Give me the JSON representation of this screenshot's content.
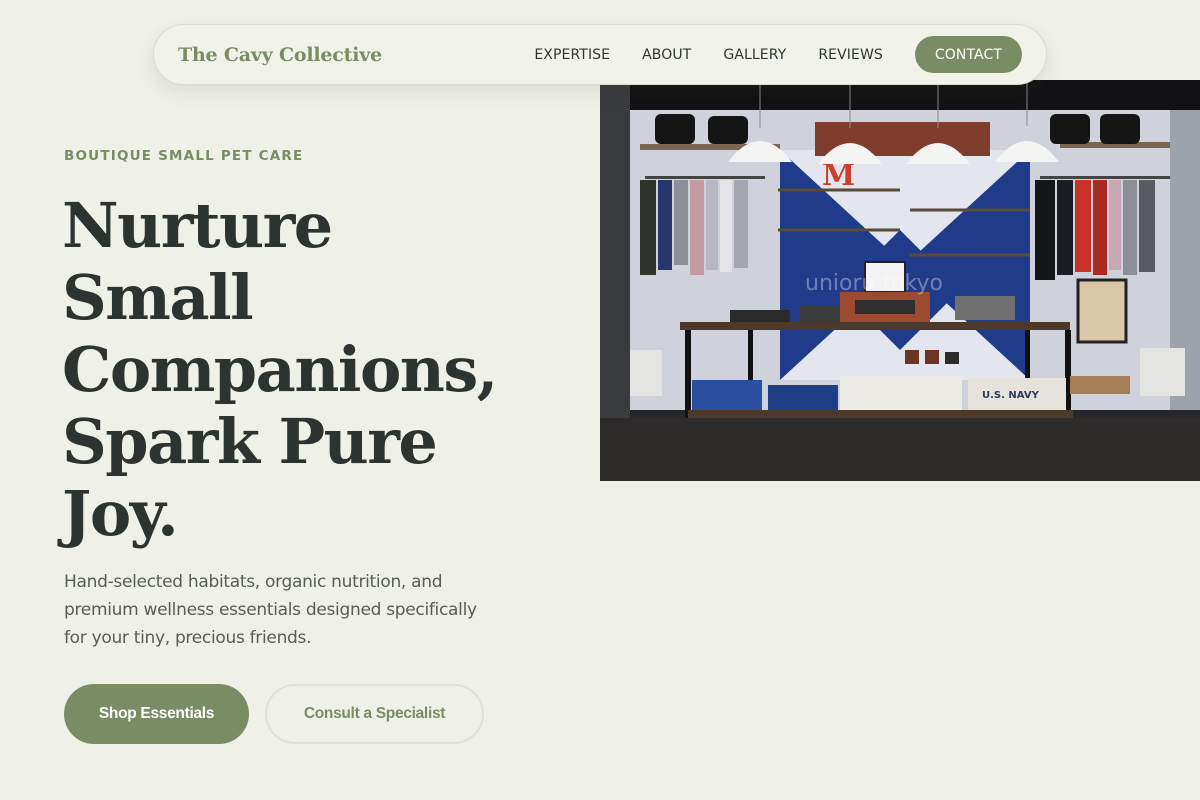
{
  "nav": {
    "brand": "The Cavy Collective",
    "links": [
      "EXPERTISE",
      "ABOUT",
      "GALLERY",
      "REVIEWS"
    ],
    "cta": "CONTACT"
  },
  "hero": {
    "eyebrow": "BOUTIQUE SMALL PET CARE",
    "headline_lines": [
      "Nurture",
      "Small",
      "Companions,",
      "Spark Pure",
      "Joy."
    ],
    "subhead": "Hand-selected habitats, organic nutrition, and premium wellness essentials designed specifically for your tiny, precious friends.",
    "primary_button": "Shop Essentials",
    "secondary_button": "Consult a Specialist"
  },
  "image": {
    "watermark_text": "unioru tokyo",
    "sign_letter": "M",
    "crate_text": "U.S. NAVY"
  },
  "colors": {
    "background": "#eff0e7",
    "accent": "#7a8c64",
    "text_dark": "#2c3331",
    "text_muted": "#575e5a"
  }
}
